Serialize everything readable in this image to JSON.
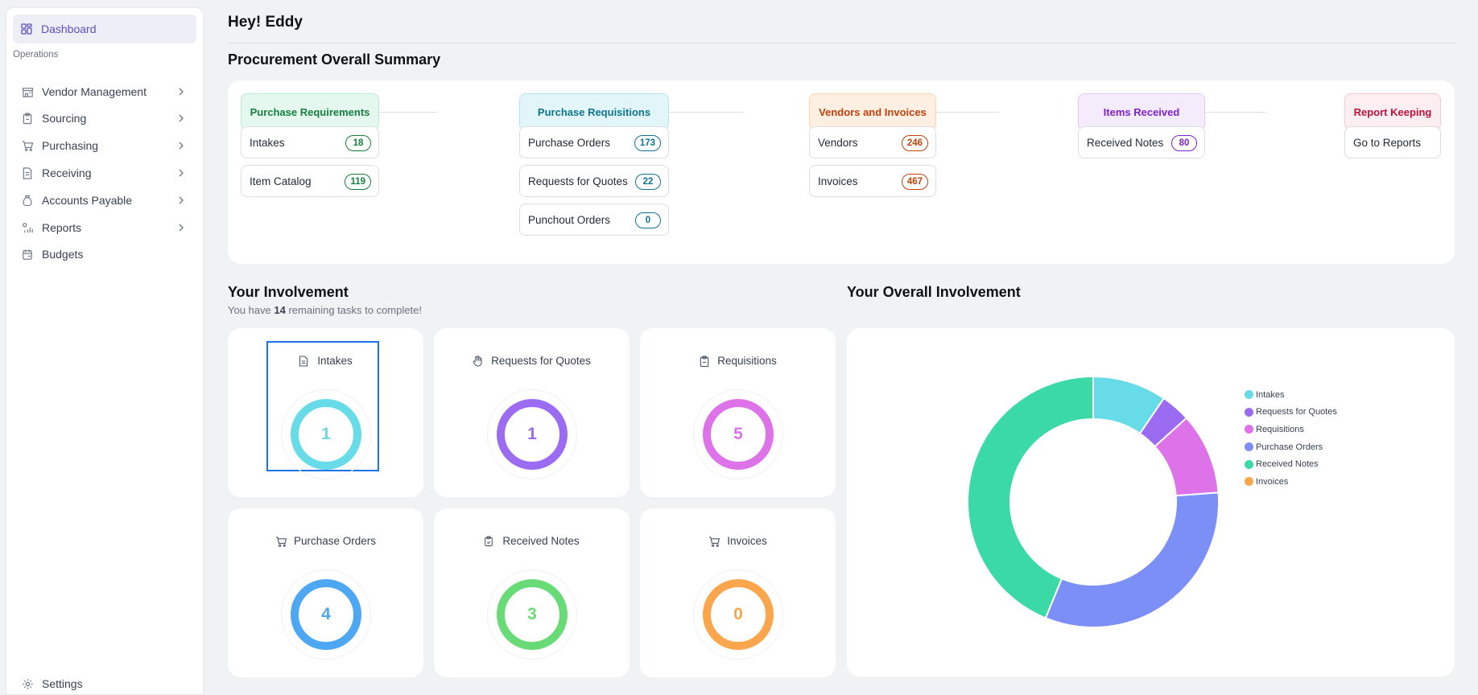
{
  "greeting": "Hey! Eddy",
  "sidebar": {
    "active": "Dashboard",
    "section": "Operations",
    "items": [
      {
        "label": "Vendor Management",
        "icon": "store-icon",
        "chevron": true
      },
      {
        "label": "Sourcing",
        "icon": "clipboard-icon",
        "chevron": true
      },
      {
        "label": "Purchasing",
        "icon": "cart-icon",
        "chevron": true
      },
      {
        "label": "Receiving",
        "icon": "receipt-icon",
        "chevron": true
      },
      {
        "label": "Accounts Payable",
        "icon": "money-bag-icon",
        "chevron": true
      },
      {
        "label": "Reports",
        "icon": "reports-icon",
        "chevron": true
      },
      {
        "label": "Budgets",
        "icon": "calendar-icon",
        "chevron": false
      }
    ],
    "settings": "Settings"
  },
  "summary": {
    "title": "Procurement Overall Summary",
    "columns": [
      {
        "header": "Purchase Requirements",
        "color": "#15803d",
        "bg": "#e5f8ef",
        "border": "#b7ebd2",
        "items": [
          {
            "label": "Intakes",
            "count": "18"
          },
          {
            "label": "Item Catalog",
            "count": "119"
          }
        ]
      },
      {
        "header": "Purchase Requisitions",
        "color": "#0e7490",
        "bg": "#e2f6fa",
        "border": "#b3e6f0",
        "items": [
          {
            "label": "Purchase Orders",
            "count": "173"
          },
          {
            "label": "Requests for Quotes",
            "count": "22"
          },
          {
            "label": "Punchout Orders",
            "count": "0"
          }
        ]
      },
      {
        "header": "Vendors and Invoices",
        "color": "#c2410c",
        "bg": "#fdf0e3",
        "border": "#f8d5b4",
        "items": [
          {
            "label": "Vendors",
            "count": "246"
          },
          {
            "label": "Invoices",
            "count": "467"
          }
        ]
      },
      {
        "header": "Items Received",
        "color": "#7e22ce",
        "bg": "#f5ecfb",
        "border": "#e2c9f5",
        "items": [
          {
            "label": "Received Notes",
            "count": "80"
          }
        ]
      },
      {
        "header": "Report Keeping",
        "color": "#be123c",
        "bg": "#fdeef1",
        "border": "#f8c8d3",
        "items": [
          {
            "label": "Go to Reports",
            "count": ""
          }
        ]
      }
    ]
  },
  "involvement": {
    "title": "Your Involvement",
    "subtitle_pre": "You have",
    "remaining": "14",
    "subtitle_post": "remaining tasks to complete!",
    "cards": [
      {
        "label": "Intakes",
        "value": "1",
        "color": "#67dbe8",
        "icon": "document-icon"
      },
      {
        "label": "Requests for Quotes",
        "value": "1",
        "color": "#9b6cf2",
        "icon": "hand-icon"
      },
      {
        "label": "Requisitions",
        "value": "5",
        "color": "#de72e8",
        "icon": "clipboard-icon"
      },
      {
        "label": "Purchase Orders",
        "value": "4",
        "color": "#4da7f2",
        "icon": "cart-icon"
      },
      {
        "label": "Received Notes",
        "value": "3",
        "color": "#69db76",
        "icon": "clipboard-check-icon"
      },
      {
        "label": "Invoices",
        "value": "0",
        "color": "#fba54c",
        "icon": "cart-icon"
      }
    ]
  },
  "overall": {
    "title": "Your Overall Involvement"
  },
  "chart_data": {
    "type": "pie",
    "donut": true,
    "categories": [
      "Intakes",
      "Requests for Quotes",
      "Requisitions",
      "Purchase Orders",
      "Received Notes",
      "Invoices"
    ],
    "values": [
      1,
      0.4,
      1.1,
      3.4,
      4.6,
      0
    ],
    "colors": [
      "#67dbe8",
      "#9b6cf2",
      "#de72e8",
      "#7b8ff7",
      "#3ad9a6",
      "#fba54c"
    ],
    "legend_position": "right"
  }
}
